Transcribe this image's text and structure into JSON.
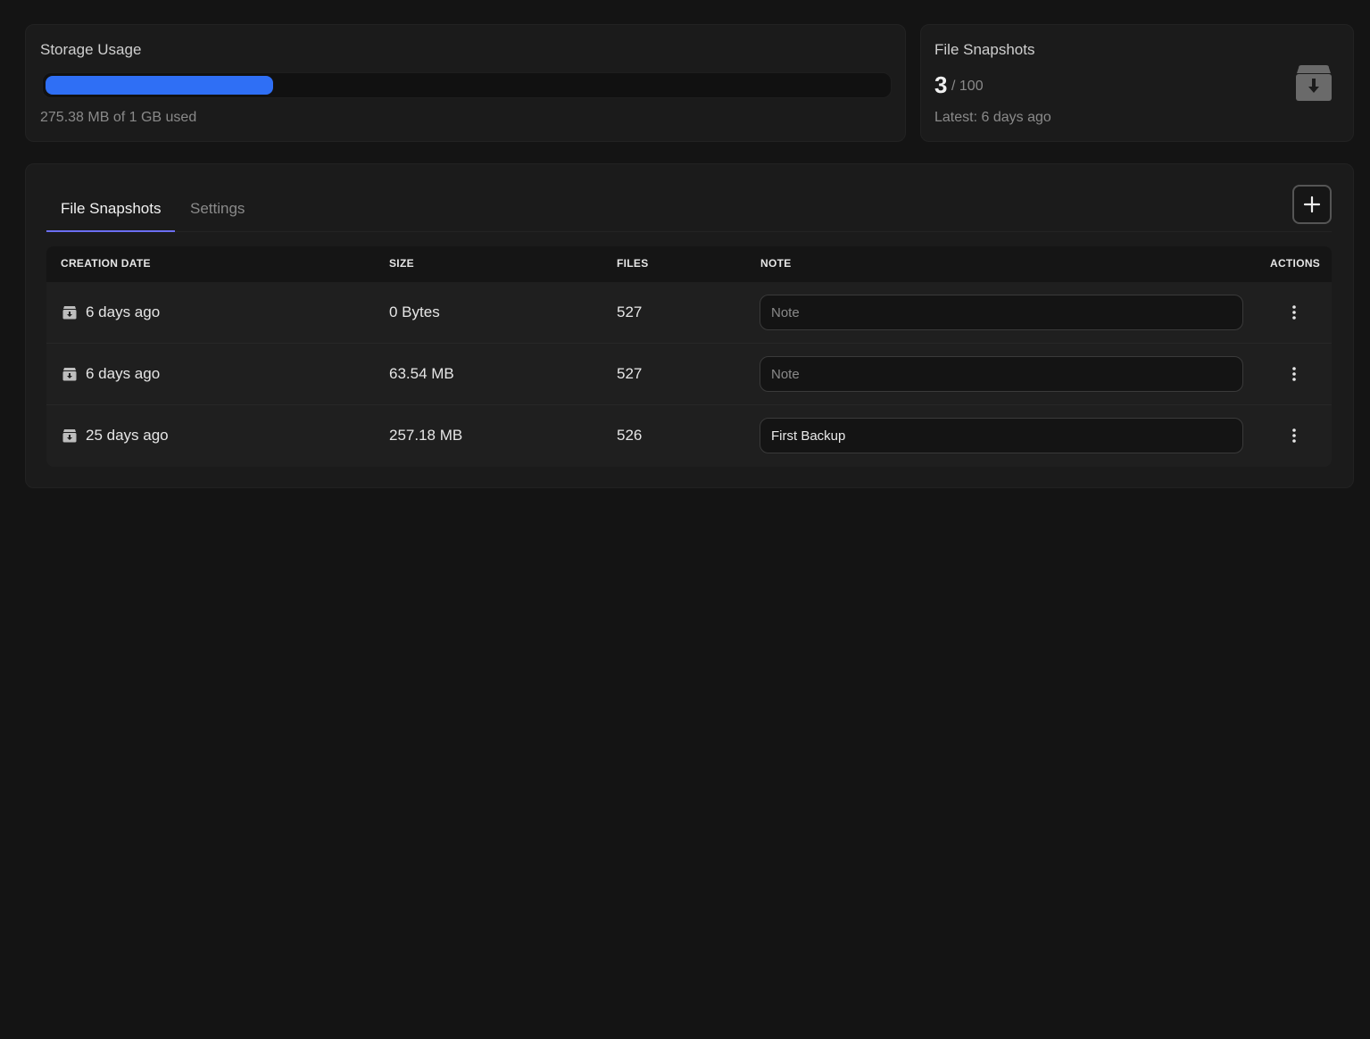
{
  "storage": {
    "title": "Storage Usage",
    "usage_text": "275.38 MB of 1 GB used",
    "progress_fraction": 0.27,
    "bar_color": "#2f6ff5"
  },
  "snapshots_summary": {
    "title": "File Snapshots",
    "count": "3",
    "limit": "/ 100",
    "latest": "Latest: 6 days ago",
    "icon": "archive-download-icon"
  },
  "tabs": [
    {
      "label": "File Snapshots",
      "active": true
    },
    {
      "label": "Settings",
      "active": false
    }
  ],
  "add_button": {
    "icon": "plus-icon"
  },
  "table": {
    "headers": {
      "creation_date": "CREATION DATE",
      "size": "SIZE",
      "files": "FILES",
      "note": "NOTE",
      "actions": "ACTIONS"
    },
    "rows": [
      {
        "date": "6 days ago",
        "size": "0 Bytes",
        "files": "527",
        "note": "",
        "note_placeholder": "Note"
      },
      {
        "date": "6 days ago",
        "size": "63.54 MB",
        "files": "527",
        "note": "",
        "note_placeholder": "Note"
      },
      {
        "date": "25 days ago",
        "size": "257.18 MB",
        "files": "526",
        "note": "First Backup",
        "note_placeholder": "Note"
      }
    ]
  },
  "colors": {
    "background": "#141414",
    "card": "#1b1b1b",
    "accent_tab": "#6b6ef2"
  }
}
